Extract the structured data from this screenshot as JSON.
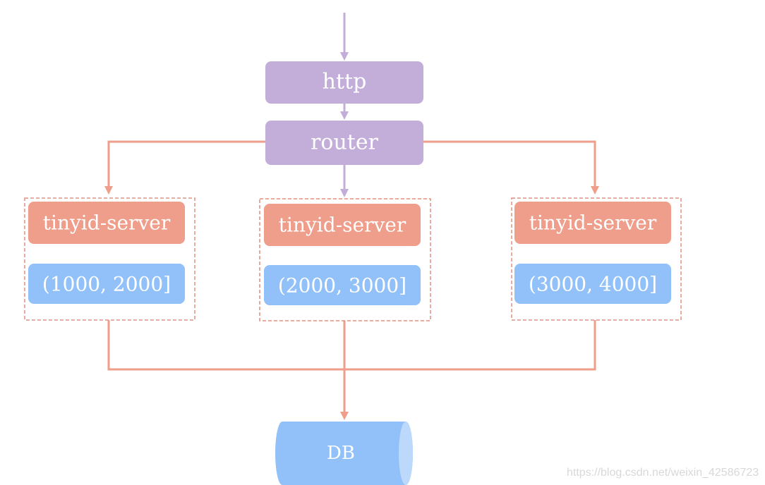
{
  "colors": {
    "purple": "#c3aed9",
    "orange": "#ee9e8a",
    "blue": "#91c1f8",
    "blue_light": "#bcd9fb"
  },
  "nodes": {
    "http": "http",
    "router": "router",
    "db": "DB"
  },
  "servers": [
    {
      "label": "tinyid-server",
      "range": "(1000, 2000]"
    },
    {
      "label": "tinyid-server",
      "range": "(2000, 3000]"
    },
    {
      "label": "tinyid-server",
      "range": "(3000, 4000]"
    }
  ],
  "watermark": "https://blog.csdn.net/weixin_42586723"
}
